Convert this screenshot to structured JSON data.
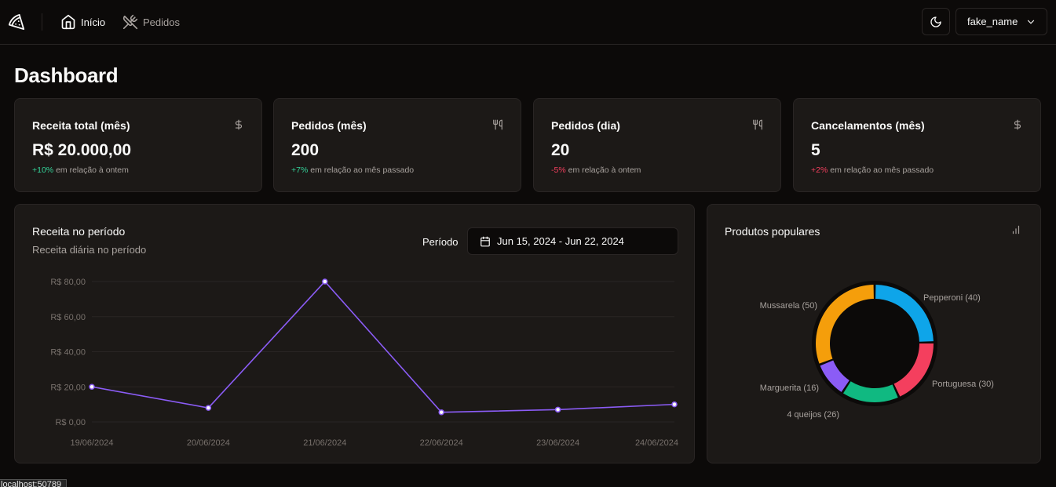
{
  "nav": {
    "home_label": "Início",
    "orders_label": "Pedidos",
    "user_name": "fake_name"
  },
  "page": {
    "title": "Dashboard"
  },
  "stats": [
    {
      "title": "Receita total (mês)",
      "value": "R$ 20.000,00",
      "delta": "+10%",
      "note": " em relação à ontem",
      "trend": "up",
      "icon": "dollar-icon"
    },
    {
      "title": "Pedidos (mês)",
      "value": "200",
      "delta": "+7%",
      "note": " em relação ao mês passado",
      "trend": "up",
      "icon": "utensils-icon"
    },
    {
      "title": "Pedidos (dia)",
      "value": "20",
      "delta": "-5%",
      "note": " em relação à ontem",
      "trend": "down",
      "icon": "utensils-icon"
    },
    {
      "title": "Cancelamentos (mês)",
      "value": "5",
      "delta": "+2%",
      "note": " em relação ao mês passado",
      "trend": "down",
      "icon": "dollar-icon"
    }
  ],
  "revenue_card": {
    "title": "Receita no período",
    "subtitle": "Receita diária no período",
    "period_label": "Período",
    "date_range": "Jun 15, 2024 - Jun 22, 2024"
  },
  "popular_card": {
    "title": "Produtos populares"
  },
  "status_bar": {
    "text": "localhost:50789"
  },
  "colors": {
    "line": "#8b5cf6",
    "pepperoni": "#0ea5e9",
    "portuguesa": "#f43f5e",
    "quatro_queijos": "#10b981",
    "marguerita": "#8b5cf6",
    "mussarela": "#f59e0b"
  },
  "chart_data": [
    {
      "type": "line",
      "x": [
        "19/06/2024",
        "20/06/2024",
        "21/06/2024",
        "22/06/2024",
        "23/06/2024",
        "24/06/2024"
      ],
      "series": [
        {
          "values": [
            20,
            8,
            80,
            5.5,
            7,
            10
          ]
        }
      ],
      "y_ticks": [
        "R$ 0,00",
        "R$ 20,00",
        "R$ 40,00",
        "R$ 60,00",
        "R$ 80,00"
      ],
      "ylim": [
        0,
        80
      ],
      "grid": true
    },
    {
      "type": "pie",
      "categories": [
        "Pepperoni",
        "Portuguesa",
        "4 queijos",
        "Marguerita",
        "Mussarela"
      ],
      "values": [
        40,
        30,
        26,
        16,
        50
      ],
      "labels": [
        "Pepperoni (40)",
        "Portuguesa (30)",
        "4 queijos (26)",
        "Marguerita (16)",
        "Mussarela (50)"
      ]
    }
  ]
}
